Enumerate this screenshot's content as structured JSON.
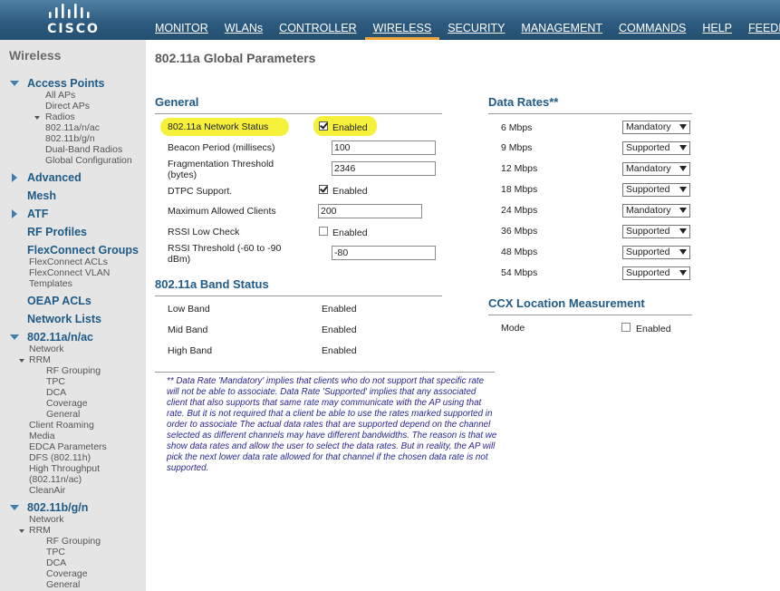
{
  "brand": {
    "name": "CISCO"
  },
  "nav": {
    "items": [
      {
        "label": "MONITOR"
      },
      {
        "label": "WLANs"
      },
      {
        "label": "CONTROLLER"
      },
      {
        "label": "WIRELESS",
        "active": true
      },
      {
        "label": "SECURITY"
      },
      {
        "label": "MANAGEMENT"
      },
      {
        "label": "COMMANDS"
      },
      {
        "label": "HELP"
      },
      {
        "label": "FEEDBACK"
      }
    ]
  },
  "sidebar": {
    "title": "Wireless",
    "access_points": "Access Points",
    "all_aps": "All APs",
    "direct_aps": "Direct APs",
    "radios": "Radios",
    "radio_a": "802.11a/n/ac",
    "radio_b": "802.11b/g/n",
    "dual_band": "Dual-Band Radios",
    "global_config": "Global Configuration",
    "advanced": "Advanced",
    "mesh": "Mesh",
    "atf": "ATF",
    "rf_profiles": "RF Profiles",
    "flexconnect_groups": "FlexConnect Groups",
    "flexconnect_acls": "FlexConnect ACLs",
    "flexconnect_vlan": "FlexConnect VLAN",
    "templates": "Templates",
    "oeap_acls": "OEAP ACLs",
    "network_lists": "Network Lists",
    "a_section": "802.11a/n/ac",
    "a_network": "Network",
    "a_rrm": "RRM",
    "a_rf_grouping": "RF Grouping",
    "a_tpc": "TPC",
    "a_dca": "DCA",
    "a_coverage": "Coverage",
    "a_general": "General",
    "a_client_roaming": "Client Roaming",
    "a_media": "Media",
    "a_edca": "EDCA Parameters",
    "a_dfs": "DFS (802.11h)",
    "a_high_throughput": "High Throughput",
    "a_high_throughput_2": "(802.11n/ac)",
    "a_cleanair": "CleanAir",
    "b_section": "802.11b/g/n",
    "b_network": "Network",
    "b_rrm": "RRM",
    "b_rf_grouping": "RF Grouping",
    "b_tpc": "TPC",
    "b_dca": "DCA",
    "b_coverage": "Coverage",
    "b_general": "General"
  },
  "page": {
    "title": "802.11a Global Parameters"
  },
  "general": {
    "heading": "General",
    "network_status_label": "802.11a Network Status",
    "network_status_value": "Enabled",
    "beacon_label": "Beacon Period (millisecs)",
    "beacon_value": "100",
    "frag_label_1": "Fragmentation Threshold",
    "frag_label_2": "(bytes)",
    "frag_value": "2346",
    "dtpc_label": "DTPC Support.",
    "dtpc_value": "Enabled",
    "max_clients_label": "Maximum Allowed Clients",
    "max_clients_value": "200",
    "rssi_low_label": "RSSI Low Check",
    "rssi_low_value": "Enabled",
    "rssi_thr_label_1": "RSSI Threshold (-60 to -90",
    "rssi_thr_label_2": "dBm)",
    "rssi_thr_value": "-80"
  },
  "band_status": {
    "heading": "802.11a Band Status",
    "rows": [
      {
        "label": "Low Band",
        "value": "Enabled"
      },
      {
        "label": "Mid Band",
        "value": "Enabled"
      },
      {
        "label": "High Band",
        "value": "Enabled"
      }
    ]
  },
  "data_rates": {
    "heading": "Data Rates**",
    "rows": [
      {
        "rate": "6 Mbps",
        "value": "Mandatory"
      },
      {
        "rate": "9 Mbps",
        "value": "Supported"
      },
      {
        "rate": "12 Mbps",
        "value": "Mandatory"
      },
      {
        "rate": "18 Mbps",
        "value": "Supported"
      },
      {
        "rate": "24 Mbps",
        "value": "Mandatory"
      },
      {
        "rate": "36 Mbps",
        "value": "Supported"
      },
      {
        "rate": "48 Mbps",
        "value": "Supported"
      },
      {
        "rate": "54 Mbps",
        "value": "Supported"
      }
    ]
  },
  "ccx": {
    "heading": "CCX Location Measurement",
    "mode_label": "Mode",
    "mode_value": "Enabled"
  },
  "footnote": "** Data Rate 'Mandatory' implies that clients who do not support that specific rate will not be able to associate. Data Rate 'Supported' implies that any associated client that also supports that same rate may communicate with the AP using that rate. But it is not required that a client be able to use the rates marked supported in order to associate The actual data rates that are supported depend on the channel selected as different channels may have different bandwidths. The reason is that we show data rates and allow the user to select the data rates. But in reality, the AP will pick the next lower data rate allowed for that channel if the chosen data rate is not supported."
}
